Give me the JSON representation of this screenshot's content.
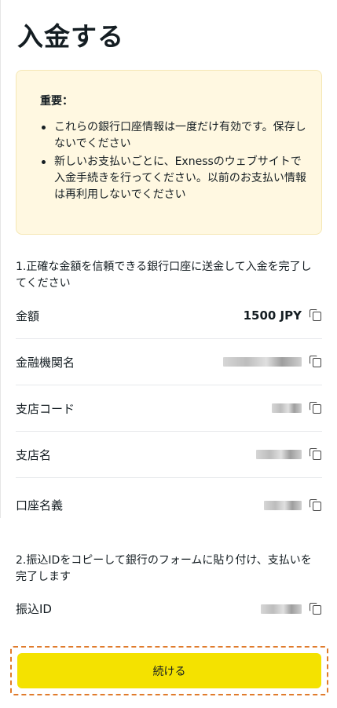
{
  "page": {
    "title": "入金する"
  },
  "notice": {
    "heading": "重要：",
    "items": [
      "これらの銀行口座情報は一度だけ有効です。保存しないでください",
      "新しいお支払いごとに、Exnessのウェブサイトで入金手続きを行ってください。以前のお支払い情報は再利用しないでください"
    ]
  },
  "step1": {
    "text": "1.正確な金額を信頼できる銀行口座に送金して入金を完了してください",
    "rows": [
      {
        "label": "金額",
        "value": "1500 JPY"
      },
      {
        "label": "金融機関名",
        "value": ""
      },
      {
        "label": "支店コード",
        "value": ""
      },
      {
        "label": "支店名",
        "value": ""
      },
      {
        "label": "口座名義",
        "value": ""
      }
    ]
  },
  "step2": {
    "text": "2.振込IDをコピーして銀行のフォームに貼り付け、支払いを完了します",
    "rows": [
      {
        "label": "振込ID",
        "value": ""
      }
    ]
  },
  "actions": {
    "continue_label": "続ける"
  },
  "colors": {
    "accent": "#f4e200",
    "notice_bg": "#fff8e1",
    "highlight_frame": "#e07b2c"
  },
  "icons": {
    "copy": "copy-icon"
  }
}
